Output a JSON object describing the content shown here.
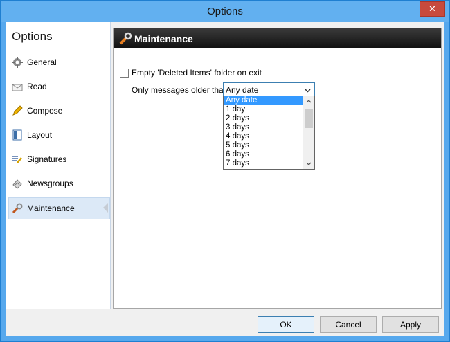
{
  "window": {
    "title": "Options",
    "close_glyph": "✕"
  },
  "sidebar": {
    "title": "Options",
    "items": [
      {
        "label": "General",
        "icon": "gear-icon"
      },
      {
        "label": "Read",
        "icon": "envelope-icon"
      },
      {
        "label": "Compose",
        "icon": "pencil-icon"
      },
      {
        "label": "Layout",
        "icon": "layout-icon"
      },
      {
        "label": "Signatures",
        "icon": "signature-icon"
      },
      {
        "label": "Newsgroups",
        "icon": "newsgroup-icon"
      },
      {
        "label": "Maintenance",
        "icon": "wrench-icon",
        "active": true
      }
    ]
  },
  "content": {
    "header": "Maintenance",
    "empty_deleted_label": "Empty 'Deleted Items' folder on exit",
    "empty_deleted_checked": false,
    "older_label": "Only messages older than:",
    "select_value": "Any date",
    "options": [
      "Any date",
      "1 day",
      "2 days",
      "3 days",
      "4 days",
      "5 days",
      "6 days",
      "7 days"
    ]
  },
  "buttons": {
    "ok": "OK",
    "cancel": "Cancel",
    "apply": "Apply"
  },
  "colors": {
    "accent": "#3399ff",
    "titlebar": "#62b0f0",
    "close": "#c74a3d"
  }
}
